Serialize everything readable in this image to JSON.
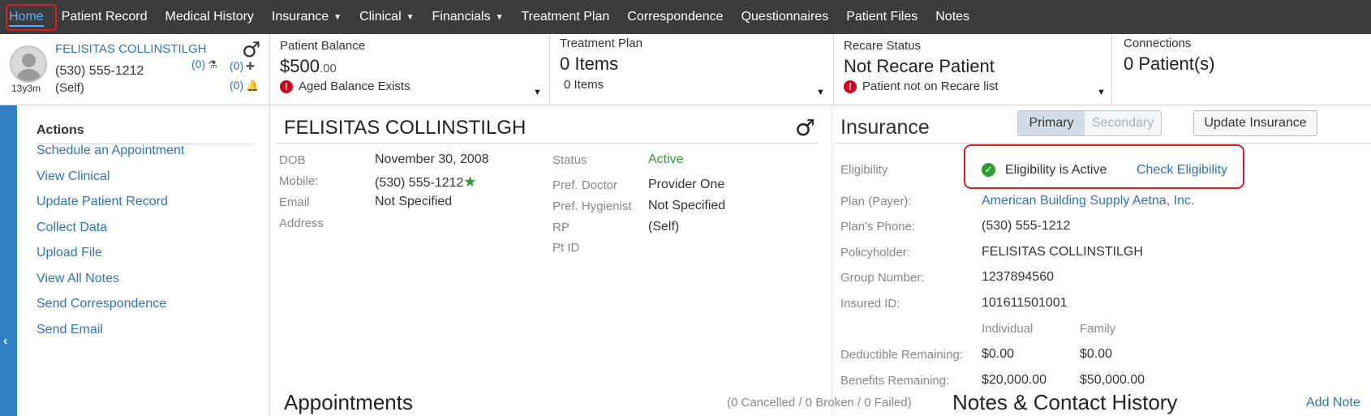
{
  "nav": {
    "items": [
      {
        "label": "Home",
        "caret": false
      },
      {
        "label": "Patient Record",
        "caret": false
      },
      {
        "label": "Medical History",
        "caret": false
      },
      {
        "label": "Insurance",
        "caret": true
      },
      {
        "label": "Clinical",
        "caret": true
      },
      {
        "label": "Financials",
        "caret": true
      },
      {
        "label": "Treatment Plan",
        "caret": false
      },
      {
        "label": "Correspondence",
        "caret": false
      },
      {
        "label": "Questionnaires",
        "caret": false
      },
      {
        "label": "Patient Files",
        "caret": false
      },
      {
        "label": "Notes",
        "caret": false
      }
    ],
    "caret_glyph": "▼"
  },
  "summary": {
    "patient": {
      "name": "FELISITAS COLLINSTILGH",
      "phone": "(530) 555-1212",
      "relation": "(Self)",
      "age": "13y3m",
      "gender_glyph": "♂",
      "count_lab": "(0)",
      "count_medical": "(0)",
      "count_alerts": "(0)"
    },
    "balance": {
      "label": "Patient Balance",
      "amount": "$500",
      "cents": ".00",
      "status": "Aged Balance Exists"
    },
    "treatment": {
      "label": "Treatment Plan",
      "value": "0 Items",
      "sub": "0 Items"
    },
    "recare": {
      "label": "Recare Status",
      "value": "Not Recare Patient",
      "status": "Patient not on Recare list"
    },
    "connections": {
      "label": "Connections",
      "value": "0 Patient(s)"
    }
  },
  "actions": {
    "title": "Actions",
    "links": [
      "Schedule an Appointment",
      "View Clinical",
      "Update Patient Record",
      "Collect Data",
      "Upload File",
      "View All Notes",
      "Send Correspondence",
      "Send Email"
    ]
  },
  "patient_info": {
    "title": "FELISITAS COLLINSTILGH",
    "dob_label": "DOB",
    "dob": "November 30, 2008",
    "mobile_label": "Mobile:",
    "mobile": "(530) 555-1212",
    "email_label": "Email",
    "email": "Not Specified",
    "address_label": "Address",
    "status_label": "Status",
    "status": "Active",
    "pref_doctor_label": "Pref. Doctor",
    "pref_doctor": "Provider One",
    "pref_hygienist_label": "Pref. Hygienist",
    "pref_hygienist": "Not Specified",
    "rp_label": "RP",
    "rp": "(Self)",
    "ptid_label": "Pt ID"
  },
  "insurance": {
    "title": "Insurance",
    "tab_primary": "Primary",
    "tab_secondary": "Secondary",
    "update_button": "Update Insurance",
    "eligibility_label": "Eligibility",
    "eligibility_status": "Eligibility is Active",
    "check_eligibility": "Check Eligibility",
    "plan_label": "Plan (Payer):",
    "plan": "American Building Supply Aetna, Inc.",
    "phone_label": "Plan's Phone:",
    "phone": "(530) 555-1212",
    "policyholder_label": "Policyholder:",
    "policyholder": "FELISITAS COLLINSTILGH",
    "group_label": "Group Number:",
    "group": "1237894560",
    "insured_label": "Insured ID:",
    "insured": "101611501001",
    "col_individual": "Individual",
    "col_family": "Family",
    "deductible_label": "Deductible Remaining:",
    "deductible_individual": "$0.00",
    "deductible_family": "$0.00",
    "benefits_label": "Benefits Remaining:",
    "benefits_individual": "$20,000.00",
    "benefits_family": "$50,000.00"
  },
  "appointments": {
    "title": "Appointments",
    "counts": "(0 Cancelled / 0 Broken / 0 Failed)"
  },
  "notes": {
    "title": "Notes & Contact History",
    "add_note": "Add Note"
  },
  "colors": {
    "nav_bg": "#3c3c3c",
    "link_blue": "#2f75b5",
    "active_green": "#2e9e2e",
    "alert_red": "#d0021b",
    "highlight_red": "#e11b22",
    "sidebar_blue": "#2f7fc4"
  }
}
